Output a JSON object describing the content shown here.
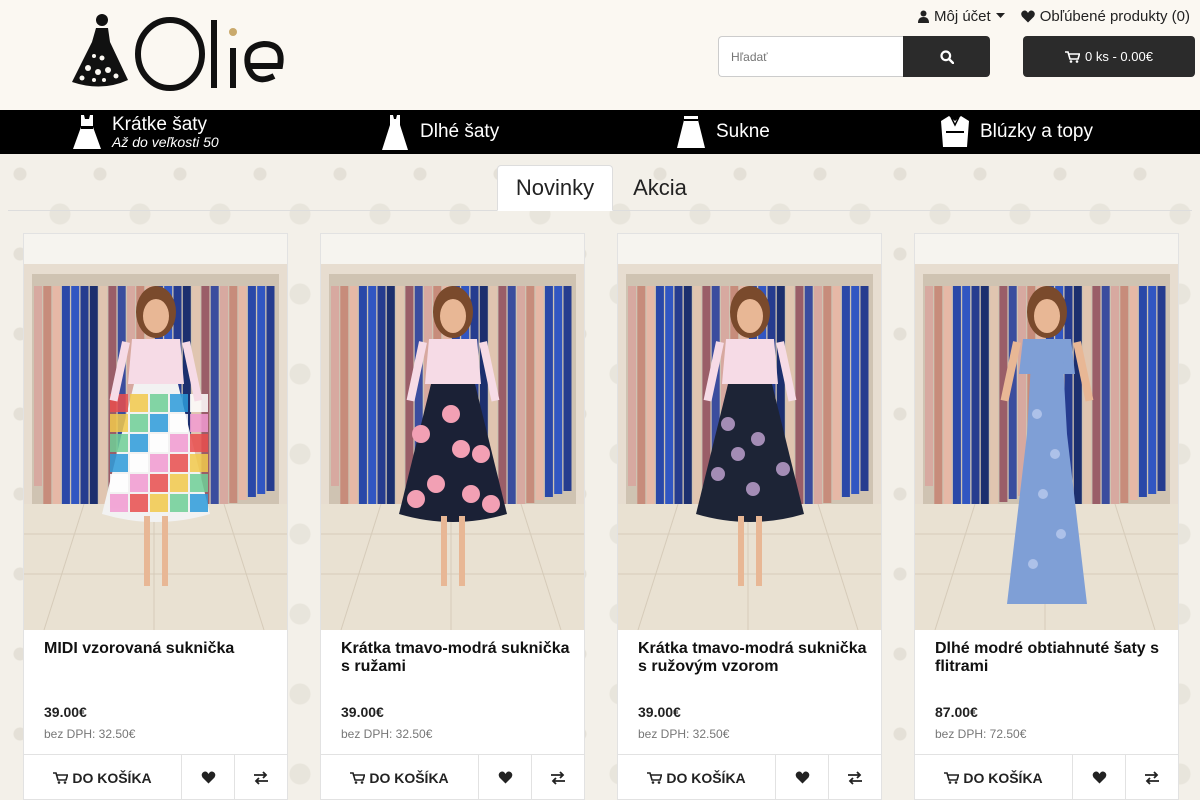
{
  "header": {
    "logo_text": "Olie",
    "account_label": "Môj účet",
    "favorites_label": "Obľúbené produkty (0)",
    "search_placeholder": "Hľadať",
    "cart_label": "0 ks - 0.00€"
  },
  "nav": {
    "items": [
      {
        "label": "Krátke šaty",
        "sub": "Až do veľkosti 50",
        "icon": "short-dress-icon"
      },
      {
        "label": "Dlhé šaty",
        "sub": "",
        "icon": "long-dress-icon"
      },
      {
        "label": "Sukne",
        "sub": "",
        "icon": "skirt-icon"
      },
      {
        "label": "Blúzky a topy",
        "sub": "",
        "icon": "blouse-icon"
      }
    ]
  },
  "tabs": [
    {
      "label": "Novinky",
      "active": true
    },
    {
      "label": "Akcia",
      "active": false
    }
  ],
  "products": [
    {
      "title": "MIDI vzorovaná suknička",
      "price": "39.00€",
      "tax": "bez DPH: 32.50€",
      "buy": "DO KOŠÍKA",
      "color": "#f2f2f2",
      "skirt": "checkered"
    },
    {
      "title": "Krátka tmavo-modrá suknička s ružami",
      "price": "39.00€",
      "tax": "bez DPH: 32.50€",
      "buy": "DO KOŠÍKA",
      "color": "#1b2136",
      "skirt": "roses"
    },
    {
      "title": "Krátka tmavo-modrá suknička s ružovým vzorom",
      "price": "39.00€",
      "tax": "bez DPH: 32.50€",
      "buy": "DO KOŠÍKA",
      "color": "#1d2436",
      "skirt": "pattern"
    },
    {
      "title": "Dlhé modré obtiahnuté šaty s flitrami",
      "price": "87.00€",
      "tax": "bez DPH: 72.50€",
      "buy": "DO KOŠÍKA",
      "color": "#7f9fd6",
      "skirt": "gown"
    }
  ],
  "colors": {
    "dark": "#2b2b2b",
    "nav": "#000000",
    "header_bg": "#fbf8f2"
  }
}
